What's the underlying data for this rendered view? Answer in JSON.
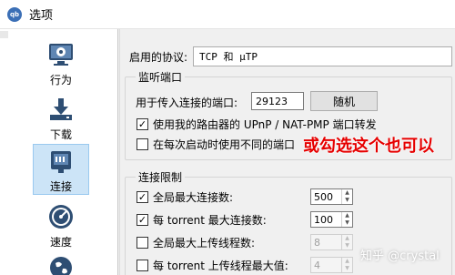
{
  "window": {
    "title": "选项",
    "app_icon_text": "qb"
  },
  "sidebar": {
    "items": [
      {
        "label": "行为",
        "icon": "monitor-gear-icon"
      },
      {
        "label": "下载",
        "icon": "download-icon"
      },
      {
        "label": "连接",
        "icon": "network-icon",
        "active": true
      },
      {
        "label": "速度",
        "icon": "speedometer-icon"
      },
      {
        "label": "",
        "icon": "globe-icon"
      }
    ]
  },
  "connection": {
    "protocol_label": "启用的协议:",
    "protocol_value": "TCP 和 μTP",
    "listen_group_title": "监听端口",
    "incoming_port_label": "用于传入连接的端口:",
    "incoming_port_value": "29123",
    "random_button": "随机",
    "upnp_label": "使用我的路由器的 UPnP / NAT-PMP 端口转发",
    "upnp_checked": true,
    "random_port_label": "在每次启动时使用不同的端口",
    "random_port_checked": false,
    "limits_group_title": "连接限制",
    "limits": [
      {
        "label": "全局最大连接数:",
        "checked": true,
        "value": "500",
        "enabled": true
      },
      {
        "label": "每 torrent 最大连接数:",
        "checked": true,
        "value": "100",
        "enabled": true
      },
      {
        "label": "全局最大上传线程数:",
        "checked": false,
        "value": "8",
        "enabled": false
      },
      {
        "label": "每 torrent 上传线程最大值:",
        "checked": false,
        "value": "4",
        "enabled": false
      }
    ]
  },
  "annotation": "或勾选这个也可以",
  "watermark": "知乎 @crystal",
  "colors": {
    "annotation": "#e60000",
    "accent": "#3b6fb6",
    "selection": "#cce4f7"
  }
}
